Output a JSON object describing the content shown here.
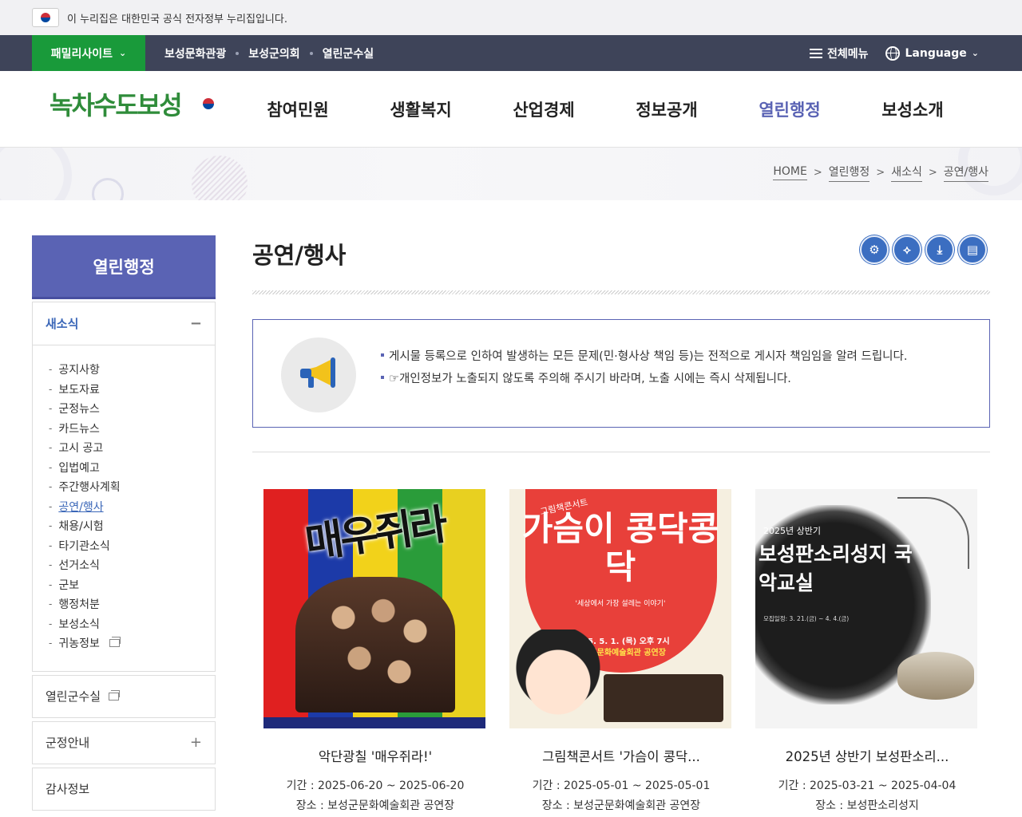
{
  "gov_bar": {
    "text": "이 누리집은 대한민국 공식 전자정부 누리집입니다."
  },
  "util_bar": {
    "family_site": "패밀리사이트",
    "links": [
      "보성문화관광",
      "보성군의회",
      "열린군수실"
    ],
    "all_menu": "전체메뉴",
    "language": "Language"
  },
  "header": {
    "logo_text": "녹차수도보성",
    "gnb": [
      "참여민원",
      "생활복지",
      "산업경제",
      "정보공개",
      "열린행정",
      "보성소개"
    ],
    "active_gnb": "열린행정"
  },
  "breadcrumb": [
    "HOME",
    "열린행정",
    "새소식",
    "공연/행사"
  ],
  "sidebar": {
    "title": "열린행정",
    "group_open": "새소식",
    "sub_items": [
      "공지사항",
      "보도자료",
      "군정뉴스",
      "카드뉴스",
      "고시 공고",
      "입법예고",
      "주간행사계획",
      "공연/행사",
      "채용/시험",
      "타기관소식",
      "선거소식",
      "군보",
      "행정처분",
      "보성소식",
      "귀농정보"
    ],
    "active_sub": "공연/행사",
    "closed_groups": [
      "열린군수실",
      "군정안내",
      "감사정보"
    ]
  },
  "content": {
    "title": "공연/행사",
    "tools": [
      "settings-icon",
      "share-icon",
      "download-icon",
      "print-icon"
    ],
    "notice_lines": [
      "게시물 등록으로 인하여 발생하는 모든 문제(민·형사상 책임 등)는 전적으로 게시자 책임임을 알려 드립니다.",
      "☞개인정보가 노출되지 않도록 주의해 주시기 바라며, 노출 시에는 즉시 삭제됩니다."
    ]
  },
  "gallery": [
    {
      "title": "악단광칠 '매우쥐라!'",
      "period": "기간 : 2025-06-20 ~ 2025-06-20",
      "place": "장소 : 보성군문화예술회관 공연장",
      "poster_title": "매우쥐라"
    },
    {
      "title": "그림책콘서트 '가슴이 콩닥...",
      "period": "기간 : 2025-05-01 ~ 2025-05-01",
      "place": "장소 : 보성군문화예술회관 공연장",
      "poster_small": "그림책콘서트",
      "poster_title": "가슴이 콩닥콩닥",
      "poster_sub": "'세상에서 가장 설레는 이야기'",
      "poster_date": "2025. 5. 1. (목) 오후 7시",
      "poster_venue": "보성군문화예술회관 공연장"
    },
    {
      "title": "2025년 상반기 보성판소리...",
      "period": "기간 : 2025-03-21 ~ 2025-04-04",
      "place": "장소 : 보성판소리성지",
      "poster_small": "2025년 상반기",
      "poster_title": "보성판소리성지 국악교실",
      "poster_info": "모집일정: 3. 21.(금) ~ 4. 4.(금)"
    }
  ],
  "colors": {
    "primary_purple": "#5a63b4",
    "util_navy": "#3e4459",
    "family_green": "#199a3a",
    "tool_blue": "#3b6ec1"
  }
}
